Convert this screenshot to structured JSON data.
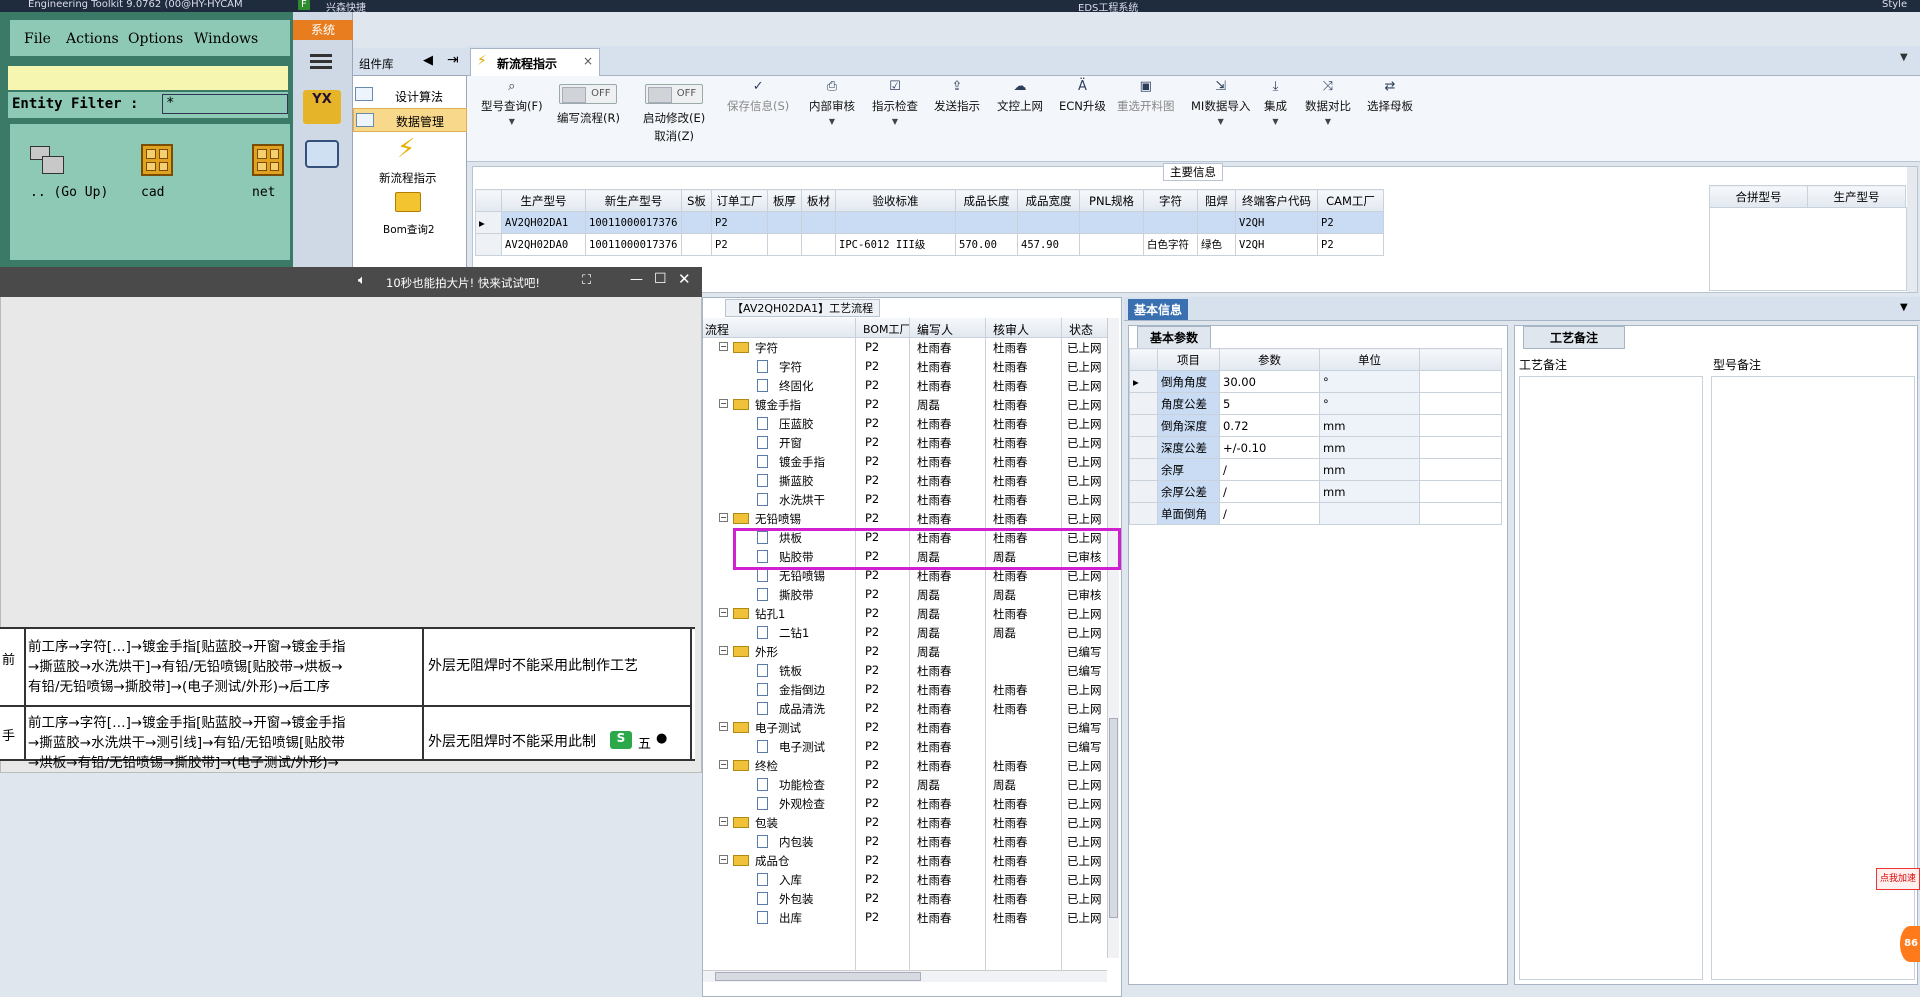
{
  "taskbar": {
    "toolkit_title": "Engineering Toolkit 9.0762 (00@HY-HYCAM",
    "app2_title": "兴森快捷",
    "center_title": "EDS工程系统",
    "style_label": "Style"
  },
  "toolkit": {
    "menu": [
      "File",
      "Actions",
      "Options",
      "Windows"
    ],
    "filter_label": "Entity Filter :",
    "filter_value": "*",
    "files": [
      {
        "name": ".. (Go Up)",
        "icon": "folder-up-icon"
      },
      {
        "name": "cad",
        "icon": "grid-folder-icon"
      },
      {
        "name": "net",
        "icon": "grid-folder-icon"
      }
    ]
  },
  "sidebar": {
    "system_tab": "系统",
    "component_lib": "组件库",
    "items": [
      "设计算法",
      "数据管理"
    ],
    "nav_items": [
      "新流程指示",
      "Bom查询2"
    ],
    "logo_text": "YX"
  },
  "tab": {
    "label": "新流程指示",
    "close": "×"
  },
  "toolbar": {
    "buttons": [
      {
        "label": "型号查询(F)",
        "icon": "search-icon"
      },
      {
        "label": "编写流程(R)",
        "toggle": "OFF"
      },
      {
        "label": "启动修改(E)",
        "toggle": "OFF",
        "sub": "取消(Z)"
      },
      {
        "label": "保存信息(S)",
        "icon": "check-icon",
        "disabled": true
      },
      {
        "label": "内部审核",
        "icon": "print-icon"
      },
      {
        "label": "指示检查",
        "icon": "check-box-icon"
      },
      {
        "label": "发送指示",
        "icon": "upload-icon"
      },
      {
        "label": "文控上网",
        "icon": "cloud-upload-icon"
      },
      {
        "label": "ECN升级",
        "icon": "ecn-icon"
      },
      {
        "label": "重选开料图",
        "icon": "image-icon",
        "disabled": true
      },
      {
        "label": "MI数据导入",
        "icon": "import-icon"
      },
      {
        "label": "集成",
        "icon": "download-icon"
      },
      {
        "label": "数据对比",
        "icon": "compare-icon"
      },
      {
        "label": "选择母板",
        "icon": "shuffle-icon"
      }
    ]
  },
  "main_info": {
    "title": "主要信息",
    "columns": [
      "生产型号",
      "新生产型号",
      "S板",
      "订单工厂",
      "板厚",
      "板材",
      "验收标准",
      "成品长度",
      "成品宽度",
      "PNL规格",
      "字符",
      "阻焊",
      "终端客户代码",
      "CAM工厂"
    ],
    "rows": [
      [
        "AV2QH02DA1",
        "10011000017376",
        "",
        "P2",
        "",
        "",
        "",
        "",
        "",
        "",
        "",
        "",
        "V2QH",
        "P2"
      ],
      [
        "AV2QH02DA0",
        "10011000017376",
        "",
        "P2",
        "",
        "",
        "IPC-6012 III级",
        "570.00",
        "457.90",
        "",
        "白色字符",
        "绿色",
        "V2QH",
        "P2"
      ]
    ],
    "side_columns": [
      "合拼型号",
      "生产型号"
    ]
  },
  "video": {
    "title": "10秒也能拍大片! 快来试试吧!",
    "rows": [
      {
        "left": "前",
        "flow": [
          "前工序→字符[…]→镀金手指[贴蓝胶→开窗→镀金手指",
          "→撕蓝胶→水洗烘干]→有铅/无铅喷锡[贴胶带→烘板→",
          "有铅/无铅喷锡→撕胶带]→(电子测试/外形)→后工序"
        ],
        "note": "外层无阻焊时不能采用此制作工艺"
      },
      {
        "left": "手",
        "flow": [
          "前工序→字符[…]→镀金手指[贴蓝胶→开窗→镀金手指",
          "→撕蓝胶→水洗烘干→测引线]→有铅/无铅喷锡[贴胶带",
          "→烘板→有铅/无铅喷锡→撕胶带]→(电子测试/外形)→"
        ],
        "note": "外层无阻焊时不能采用此制"
      }
    ],
    "ime": "五"
  },
  "flow": {
    "title": "【AV2QH02DA1】工艺流程",
    "columns": [
      "流程",
      "BOM工厂",
      "编写人",
      "核审人",
      "状态"
    ],
    "rows": [
      {
        "lv": 0,
        "name": "字符",
        "f": "P2",
        "w": "杜雨春",
        "c": "杜雨春",
        "s": "已上网"
      },
      {
        "lv": 1,
        "name": "字符",
        "f": "P2",
        "w": "杜雨春",
        "c": "杜雨春",
        "s": "已上网"
      },
      {
        "lv": 1,
        "name": "终固化",
        "f": "P2",
        "w": "杜雨春",
        "c": "杜雨春",
        "s": "已上网"
      },
      {
        "lv": 0,
        "name": "镀金手指",
        "f": "P2",
        "w": "周磊",
        "c": "杜雨春",
        "s": "已上网"
      },
      {
        "lv": 1,
        "name": "压蓝胶",
        "f": "P2",
        "w": "杜雨春",
        "c": "杜雨春",
        "s": "已上网"
      },
      {
        "lv": 1,
        "name": "开窗",
        "f": "P2",
        "w": "杜雨春",
        "c": "杜雨春",
        "s": "已上网"
      },
      {
        "lv": 1,
        "name": "镀金手指",
        "f": "P2",
        "w": "杜雨春",
        "c": "杜雨春",
        "s": "已上网"
      },
      {
        "lv": 1,
        "name": "撕蓝胶",
        "f": "P2",
        "w": "杜雨春",
        "c": "杜雨春",
        "s": "已上网"
      },
      {
        "lv": 1,
        "name": "水洗烘干",
        "f": "P2",
        "w": "杜雨春",
        "c": "杜雨春",
        "s": "已上网"
      },
      {
        "lv": 0,
        "name": "无铅喷锡",
        "f": "P2",
        "w": "杜雨春",
        "c": "杜雨春",
        "s": "已上网"
      },
      {
        "lv": 1,
        "name": "烘板",
        "f": "P2",
        "w": "杜雨春",
        "c": "杜雨春",
        "s": "已上网"
      },
      {
        "lv": 1,
        "name": "贴胶带",
        "f": "P2",
        "w": "周磊",
        "c": "周磊",
        "s": "已审核"
      },
      {
        "lv": 1,
        "name": "无铅喷锡",
        "f": "P2",
        "w": "杜雨春",
        "c": "杜雨春",
        "s": "已上网"
      },
      {
        "lv": 1,
        "name": "撕胶带",
        "f": "P2",
        "w": "周磊",
        "c": "周磊",
        "s": "已审核"
      },
      {
        "lv": 0,
        "name": "钻孔1",
        "f": "P2",
        "w": "周磊",
        "c": "杜雨春",
        "s": "已上网"
      },
      {
        "lv": 1,
        "name": "二钻1",
        "f": "P2",
        "w": "周磊",
        "c": "周磊",
        "s": "已上网"
      },
      {
        "lv": 0,
        "name": "外形",
        "f": "P2",
        "w": "周磊",
        "c": "",
        "s": "已编写"
      },
      {
        "lv": 1,
        "name": "铣板",
        "f": "P2",
        "w": "杜雨春",
        "c": "",
        "s": "已编写"
      },
      {
        "lv": 1,
        "name": "金指倒边",
        "f": "P2",
        "w": "杜雨春",
        "c": "杜雨春",
        "s": "已上网"
      },
      {
        "lv": 1,
        "name": "成品清洗",
        "f": "P2",
        "w": "杜雨春",
        "c": "杜雨春",
        "s": "已上网"
      },
      {
        "lv": 0,
        "name": "电子测试",
        "f": "P2",
        "w": "杜雨春",
        "c": "",
        "s": "已编写"
      },
      {
        "lv": 1,
        "name": "电子测试",
        "f": "P2",
        "w": "杜雨春",
        "c": "",
        "s": "已编写"
      },
      {
        "lv": 0,
        "name": "终检",
        "f": "P2",
        "w": "杜雨春",
        "c": "杜雨春",
        "s": "已上网"
      },
      {
        "lv": 1,
        "name": "功能检查",
        "f": "P2",
        "w": "周磊",
        "c": "周磊",
        "s": "已上网"
      },
      {
        "lv": 1,
        "name": "外观检查",
        "f": "P2",
        "w": "杜雨春",
        "c": "杜雨春",
        "s": "已上网"
      },
      {
        "lv": 0,
        "name": "包装",
        "f": "P2",
        "w": "杜雨春",
        "c": "杜雨春",
        "s": "已上网"
      },
      {
        "lv": 1,
        "name": "内包装",
        "f": "P2",
        "w": "杜雨春",
        "c": "杜雨春",
        "s": "已上网"
      },
      {
        "lv": 0,
        "name": "成品仓",
        "f": "P2",
        "w": "杜雨春",
        "c": "杜雨春",
        "s": "已上网"
      },
      {
        "lv": 1,
        "name": "入库",
        "f": "P2",
        "w": "杜雨春",
        "c": "杜雨春",
        "s": "已上网"
      },
      {
        "lv": 1,
        "name": "外包装",
        "f": "P2",
        "w": "杜雨春",
        "c": "杜雨春",
        "s": "已上网"
      },
      {
        "lv": 1,
        "name": "出库",
        "f": "P2",
        "w": "杜雨春",
        "c": "杜雨春",
        "s": "已上网"
      }
    ]
  },
  "basic": {
    "tab": "基本信息",
    "params_tab": "基本参数",
    "columns": [
      "项目",
      "参数",
      "单位"
    ],
    "rows": [
      [
        "倒角角度",
        "30.00",
        "°"
      ],
      [
        "角度公差",
        "5",
        "°"
      ],
      [
        "倒角深度",
        "0.72",
        "mm"
      ],
      [
        "深度公差",
        "+/-0.10",
        "mm"
      ],
      [
        "余厚",
        "/",
        "mm"
      ],
      [
        "余厚公差",
        "/",
        "mm"
      ],
      [
        "单面倒角",
        "/",
        ""
      ]
    ],
    "remarks_tab": "工艺备注",
    "remark_cols": [
      "工艺备注",
      "型号备注"
    ]
  },
  "ad": {
    "text": "点我加速",
    "badge": "86"
  }
}
